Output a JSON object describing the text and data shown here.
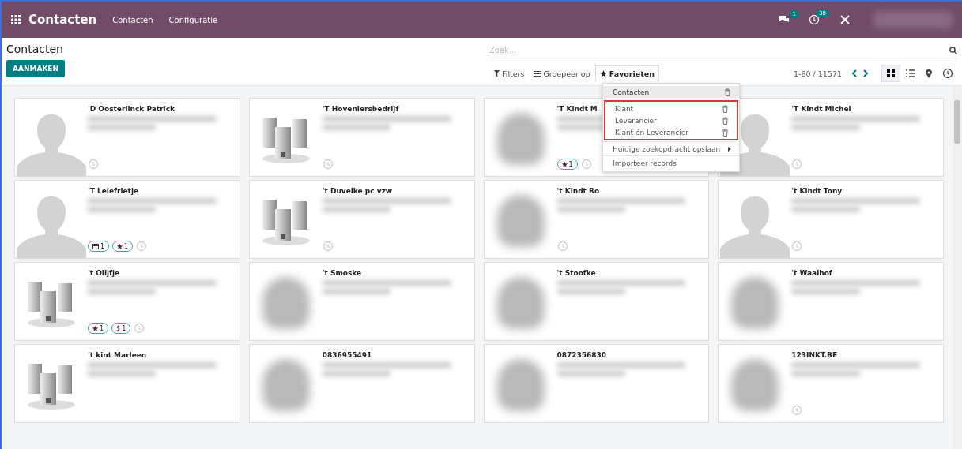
{
  "navbar": {
    "app_name": "Contacten",
    "menu": [
      "Contacten",
      "Configuratie"
    ],
    "messages_count": "1",
    "activities_count": "38"
  },
  "control_panel": {
    "title": "Contacten",
    "create_button": "AANMAKEN",
    "search": {
      "placeholder": "Zoek..."
    },
    "filters": [
      {
        "kind": "filter",
        "label": "Filters",
        "selected": false
      },
      {
        "kind": "group",
        "label": "Groepeer op",
        "selected": false
      },
      {
        "kind": "favorite",
        "label": "Favorieten",
        "selected": true
      }
    ],
    "pager": "1-80 / 11571",
    "views": [
      {
        "kind": "kanban",
        "selected": true
      },
      {
        "kind": "list",
        "selected": false
      },
      {
        "kind": "map",
        "selected": false
      },
      {
        "kind": "activity",
        "selected": false
      }
    ]
  },
  "favorites_menu": {
    "sections": [
      {
        "highlighted": false,
        "items": [
          {
            "kind": "filter",
            "label": "Contacten",
            "selected": true
          }
        ]
      },
      {
        "highlighted": true,
        "items": [
          {
            "kind": "filter",
            "label": "Klant",
            "selected": false
          },
          {
            "kind": "filter",
            "label": "Leverancier",
            "selected": false
          },
          {
            "kind": "filter",
            "label": "Klant én Leverancier",
            "selected": false
          }
        ]
      },
      {
        "highlighted": false,
        "items": [
          {
            "kind": "submenu",
            "label": "Huidige zoekopdracht opslaan",
            "selected": false
          }
        ]
      },
      {
        "highlighted": false,
        "items": [
          {
            "kind": "action",
            "label": "Importeer records",
            "selected": false
          }
        ]
      }
    ]
  },
  "cards": [
    {
      "name": "'D Oosterlinck Patrick",
      "kind": "person",
      "activity": true
    },
    {
      "name": "'T Hoveniersbedrijf",
      "kind": "company",
      "activity": true
    },
    {
      "name": "'T Kindt M",
      "kind": "blurred",
      "badges": [
        {
          "kind": "star",
          "count": "1"
        }
      ],
      "activity": true
    },
    {
      "name": "'T Kindt Michel",
      "kind": "person",
      "activity": true
    },
    {
      "name": "'T Leiefrietje",
      "kind": "person",
      "badges": [
        {
          "kind": "card",
          "count": "1"
        },
        {
          "kind": "star",
          "count": "1"
        }
      ],
      "activity": true
    },
    {
      "name": "'t Duvelke pc vzw",
      "kind": "company",
      "activity": true
    },
    {
      "name": "'t Kindt Ro",
      "kind": "blurred",
      "activity": true
    },
    {
      "name": "'t Kindt Tony",
      "kind": "person",
      "activity": true
    },
    {
      "name": "'t Olijfje",
      "kind": "company",
      "badges": [
        {
          "kind": "star",
          "count": "1"
        },
        {
          "kind": "money",
          "symbol": "$",
          "count": "1"
        }
      ],
      "activity": true
    },
    {
      "name": "'t Smoske",
      "kind": "blurred",
      "activity": false
    },
    {
      "name": "'t Stoofke",
      "kind": "blurred",
      "activity": false
    },
    {
      "name": "'t Waaihof",
      "kind": "blurred",
      "activity": false
    },
    {
      "name": "'t kint Marleen",
      "kind": "company",
      "activity": false
    },
    {
      "name": "0836955491",
      "kind": "blurred",
      "activity": false
    },
    {
      "name": "0872356830",
      "kind": "blurred",
      "activity": false
    },
    {
      "name": "123INKT.BE",
      "kind": "blurred",
      "activity": true
    }
  ]
}
